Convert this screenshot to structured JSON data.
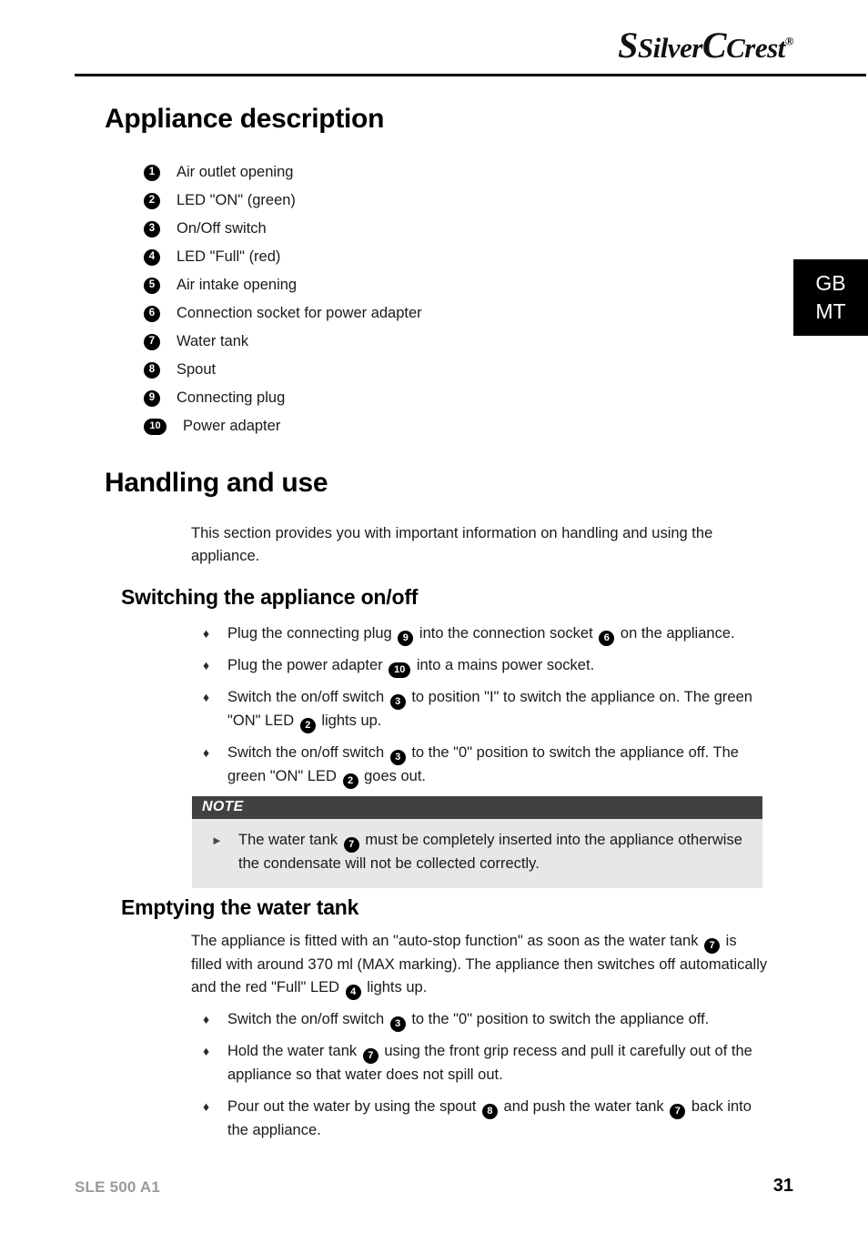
{
  "header": {
    "brand_silver": "Silver",
    "brand_crest": "Crest",
    "brand_registered": "®"
  },
  "language_tab": {
    "line1": "GB",
    "line2": "MT"
  },
  "sections": {
    "appliance_description": {
      "title": "Appliance description",
      "items": [
        {
          "num": "1",
          "label": "Air outlet opening"
        },
        {
          "num": "2",
          "label": "LED \"ON\" (green)"
        },
        {
          "num": "3",
          "label": "On/Off switch"
        },
        {
          "num": "4",
          "label": "LED \"Full\" (red)"
        },
        {
          "num": "5",
          "label": "Air intake opening"
        },
        {
          "num": "6",
          "label": "Connection socket for power adapter"
        },
        {
          "num": "7",
          "label": "Water tank"
        },
        {
          "num": "8",
          "label": "Spout"
        },
        {
          "num": "9",
          "label": "Connecting plug"
        },
        {
          "num": "10",
          "label": "Power adapter"
        }
      ]
    },
    "handling_and_use": {
      "title": "Handling and use",
      "intro": "This section provides you with important information on handling and using the appliance."
    },
    "switching_on_off": {
      "title": "Switching the appliance on/off",
      "bullets": {
        "b1_a": "Plug the connecting plug",
        "b1_n1": "9",
        "b1_b": "into the connection socket",
        "b1_n2": "6",
        "b1_c": "on the appliance.",
        "b2_a": "Plug the power adapter",
        "b2_n1": "10",
        "b2_b": "into a mains power socket.",
        "b3_a": "Switch the on/off switch",
        "b3_n1": "3",
        "b3_b": "to position \"I\" to switch the appliance on. The green \"ON\" LED",
        "b3_n2": "2",
        "b3_c": "lights up.",
        "b4_a": "Switch the on/off switch",
        "b4_n1": "3",
        "b4_b": "to the \"0\" position to switch the appliance off. The green \"ON\" LED",
        "b4_n2": "2",
        "b4_c": "goes out."
      },
      "note": {
        "heading": "NOTE",
        "text_a": "The water tank",
        "text_n1": "7",
        "text_b": "must be completely inserted into the appliance otherwise the condensate will not be collected correctly.",
        "bullet_glyph": "►"
      }
    },
    "emptying_water_tank": {
      "title": "Emptying the water tank",
      "para_a": "The appliance is fitted with an \"auto-stop function\" as soon as the water tank",
      "para_n1": "7",
      "para_b": "is filled with around 370 ml (MAX marking). The appliance then switches off automatically and the red \"Full\" LED",
      "para_n2": "4",
      "para_c": "lights up.",
      "bullets": {
        "b1_a": "Switch the on/off switch",
        "b1_n1": "3",
        "b1_b": "to the \"0\" position to switch the appliance off.",
        "b2_a": "Hold the water tank",
        "b2_n1": "7",
        "b2_b": "using the front grip recess and pull it carefully out of the appliance so that water does not spill out.",
        "b3_a": "Pour out the water by using the spout",
        "b3_n1": "8",
        "b3_b": "and push the water tank",
        "b3_n2": "7",
        "b3_c": "back into the appliance."
      }
    }
  },
  "bullet_glyph": "♦",
  "footer": {
    "model": "SLE 500 A1",
    "page_number": "31"
  },
  "colors": {
    "badge_bg": "#000000",
    "note_header_bg": "#414141",
    "note_body_bg": "#e7e7e7",
    "footer_model": "#9a9a9a"
  }
}
